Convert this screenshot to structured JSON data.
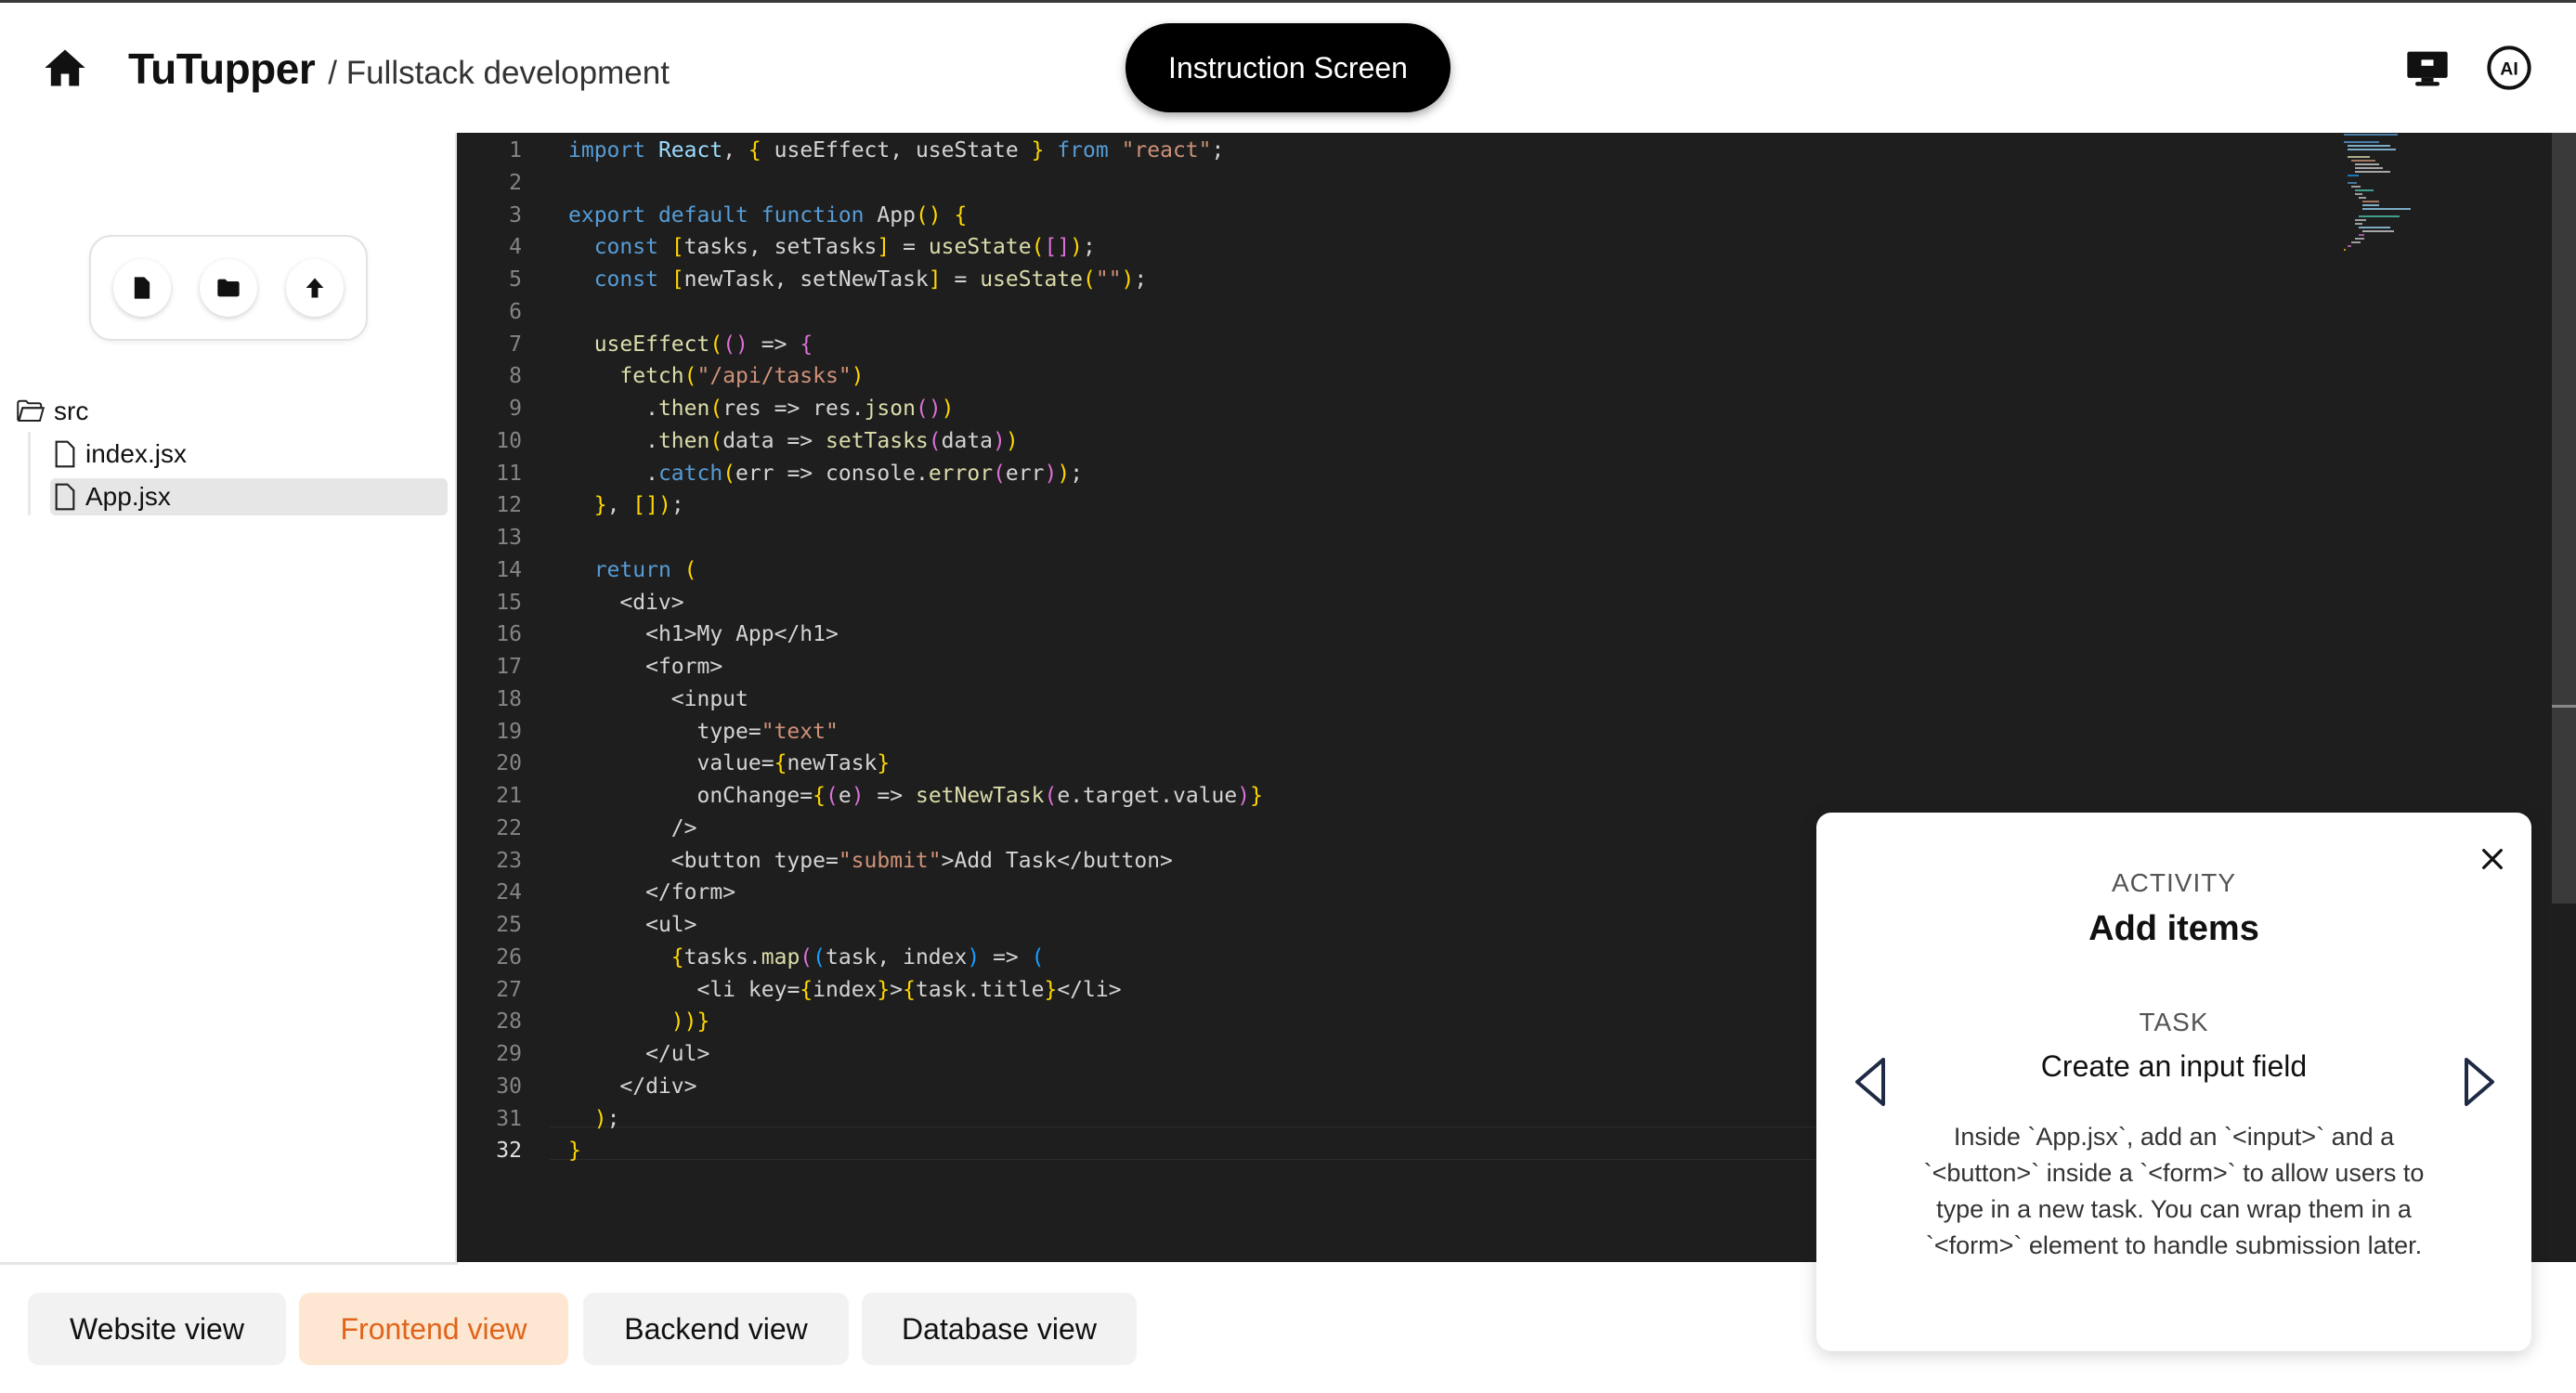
{
  "header": {
    "brand_title": "TuTupper",
    "brand_subtitle": "/ Fullstack development",
    "instruction_button": "Instruction Screen"
  },
  "sidebar": {
    "folder": "src",
    "files": [
      "index.jsx",
      "App.jsx"
    ],
    "selected_file": "App.jsx"
  },
  "editor": {
    "active_line": 32,
    "lines": [
      "import React, { useEffect, useState } from \"react\";",
      "",
      "export default function App() {",
      "  const [tasks, setTasks] = useState([]);",
      "  const [newTask, setNewTask] = useState(\"\");",
      "",
      "  useEffect(() => {",
      "    fetch(\"/api/tasks\")",
      "      .then(res => res.json())",
      "      .then(data => setTasks(data))",
      "      .catch(err => console.error(err));",
      "  }, []);",
      "",
      "  return (",
      "    <div>",
      "      <h1>My App</h1>",
      "      <form>",
      "        <input",
      "          type=\"text\"",
      "          value={newTask}",
      "          onChange={(e) => setNewTask(e.target.value)}",
      "        />",
      "        <button type=\"submit\">Add Task</button>",
      "      </form>",
      "      <ul>",
      "        {tasks.map((task, index) => (",
      "          <li key={index}>{task.title}</li>",
      "        ))}",
      "      </ul>",
      "    </div>",
      "  );",
      "}"
    ]
  },
  "views": {
    "tabs": [
      "Website view",
      "Frontend view",
      "Backend view",
      "Database view"
    ],
    "active": "Frontend view"
  },
  "activity": {
    "label": "ACTIVITY",
    "title": "Add items",
    "task_label": "TASK",
    "task_title": "Create an input field",
    "task_body": "Inside `App.jsx`, add an `<input>` and a `<button>` inside a `<form>` to allow users to type in a new task. You can wrap them in a `<form>` element to handle submission later."
  },
  "colors": {
    "accent": "#e0641a",
    "accent_bg": "#fde7d2",
    "editor_bg": "#1e1e1e"
  }
}
